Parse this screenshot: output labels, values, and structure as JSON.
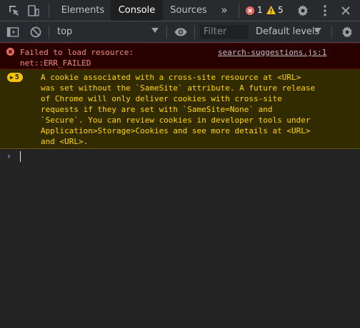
{
  "tabs": [
    {
      "label": "Elements",
      "active": false
    },
    {
      "label": "Console",
      "active": true
    },
    {
      "label": "Sources",
      "active": false
    }
  ],
  "more_tabs_label": "»",
  "error_count": "1",
  "warning_count": "5",
  "toolbar": {
    "context": "top",
    "filter_placeholder": "Filter",
    "levels": "Default levels"
  },
  "messages": {
    "error": {
      "lines": [
        "Failed to load resource:",
        "net::ERR_FAILED"
      ],
      "source": "search-suggestions.js:1"
    },
    "warning": {
      "repeat_count": "5",
      "lines": [
        "A cookie associated with a cross-site resource at <URL>",
        "was set without the `SameSite` attribute. A future release",
        "of Chrome will only deliver cookies with cross-site",
        "requests if they are set with `SameSite=None` and",
        "`Secure`. You can review cookies in developer tools under",
        "Application>Storage>Cookies and see more details at <URL>",
        "and <URL>."
      ]
    }
  },
  "prompt_symbol": "›",
  "colors": {
    "error_text": "#f28b82",
    "warning_text": "#ffd500",
    "accent": "#8ab4f8"
  }
}
